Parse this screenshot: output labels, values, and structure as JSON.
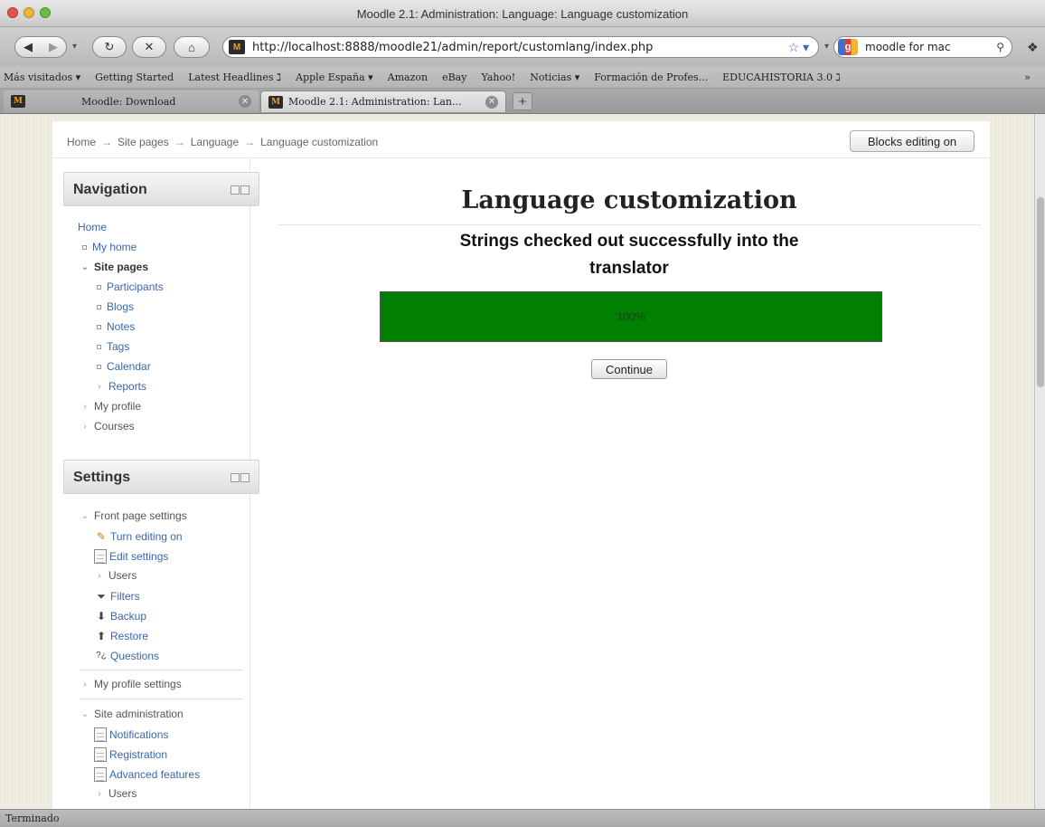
{
  "window": {
    "title": "Moodle 2.1: Administration: Language: Language customization"
  },
  "toolbar": {
    "back_icon": "back-arrow-icon",
    "url": "http://localhost:8888/moodle21/admin/report/customlang/index.php",
    "search_value": "moodle for mac"
  },
  "bookmarks": [
    "Más visitados ▾",
    "Getting Started",
    "Latest Headlines ℷ",
    "Apple España ▾",
    "Amazon",
    "eBay",
    "Yahoo!",
    "Noticias ▾",
    "Formación de Profes...",
    "EDUCAHISTORIA 3.0 ℷ",
    "»"
  ],
  "tabs": [
    {
      "label": "Moodle: Download",
      "active": false
    },
    {
      "label": "Moodle 2.1: Administration: Lan...",
      "active": true
    }
  ],
  "breadcrumb": {
    "items": [
      "Home",
      "Site pages",
      "Language",
      "Language customization"
    ],
    "separator": "→"
  },
  "header": {
    "blocks_editing_button": "Blocks editing on"
  },
  "navigation": {
    "title": "Navigation",
    "home": "Home",
    "my_home": "My home",
    "site_pages": "Site pages",
    "participants": "Participants",
    "blogs": "Blogs",
    "notes": "Notes",
    "tags": "Tags",
    "calendar": "Calendar",
    "reports": "Reports",
    "my_profile": "My profile",
    "courses": "Courses"
  },
  "settings": {
    "title": "Settings",
    "front_page_settings": "Front page settings",
    "turn_editing_on": "Turn editing on",
    "edit_settings": "Edit settings",
    "users": "Users",
    "filters": "Filters",
    "backup": "Backup",
    "restore": "Restore",
    "questions": "Questions",
    "my_profile_settings": "My profile settings",
    "site_administration": "Site administration",
    "notifications": "Notifications",
    "registration": "Registration",
    "advanced_features": "Advanced features",
    "users2": "Users"
  },
  "main": {
    "title": "Language customization",
    "notice_line1": "Strings checked out successfully into the",
    "notice_line2": "translator",
    "progress_percent": 100,
    "progress_label": "100%",
    "continue_button": "Continue"
  },
  "colors": {
    "progress_fill": "#007f00",
    "link": "#3a66b0"
  },
  "status_bar": {
    "text": "Terminado"
  }
}
